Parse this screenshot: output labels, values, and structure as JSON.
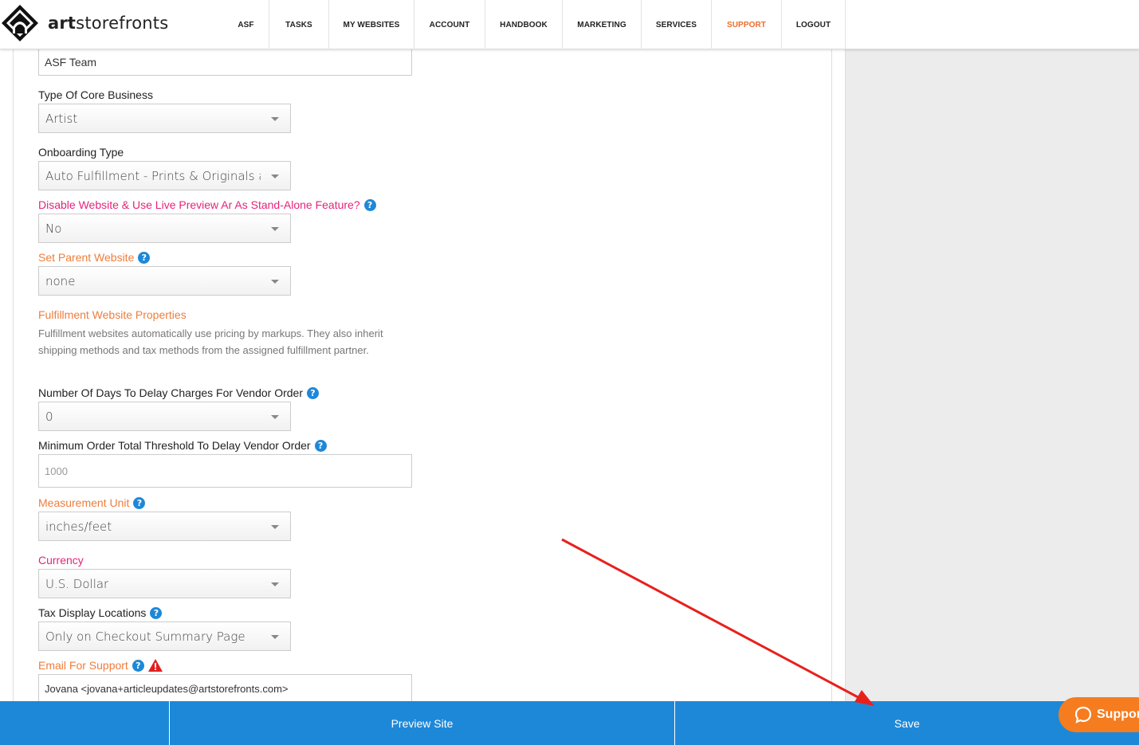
{
  "header": {
    "logo_bold": "art",
    "logo_rest": "storefronts",
    "nav": [
      {
        "label": "ASF"
      },
      {
        "label": "TASKS"
      },
      {
        "label": "MY WEBSITES"
      },
      {
        "label": "ACCOUNT"
      },
      {
        "label": "HANDBOOK"
      },
      {
        "label": "MARKETING"
      },
      {
        "label": "SERVICES"
      },
      {
        "label": "SUPPORT",
        "active": true
      },
      {
        "label": "LOGOUT"
      }
    ]
  },
  "form": {
    "team_input_value": "ASF Team",
    "core_business": {
      "label": "Type Of Core Business",
      "value": "Artist"
    },
    "onboarding": {
      "label": "Onboarding Type",
      "value": "Auto Fulfillment - Prints & Originals and/or Services"
    },
    "disable_site": {
      "label": "Disable Website & Use Live Preview Ar As Stand-Alone Feature?",
      "value": "No"
    },
    "parent_site": {
      "label": "Set Parent Website",
      "value": "none"
    },
    "fulfillment": {
      "heading": "Fulfillment Website Properties",
      "description": "Fulfillment websites automatically use pricing by markups. They also inherit shipping methods and tax methods from the assigned fulfillment partner."
    },
    "delay_days": {
      "label": "Number Of Days To Delay Charges For Vendor Order",
      "value": "0"
    },
    "min_threshold": {
      "label": "Minimum Order Total Threshold To Delay Vendor Order",
      "placeholder": "1000"
    },
    "measurement": {
      "label": "Measurement Unit",
      "value": "inches/feet"
    },
    "currency": {
      "label": "Currency",
      "value": "U.S. Dollar"
    },
    "tax_display": {
      "label": "Tax Display Locations",
      "value": "Only on Checkout Summary Page"
    },
    "email_support": {
      "label": "Email For Support",
      "value": "Jovana <jovana+articleupdates@artstorefronts.com>"
    }
  },
  "bottom_bar": {
    "preview_label": "Preview Site",
    "save_label": "Save"
  },
  "support_widget": {
    "label": "Support"
  },
  "colors": {
    "accent_blue": "#1e88d8",
    "orange": "#ef7d3c",
    "pink": "#e4247a",
    "annotation_red": "#e8201c"
  }
}
